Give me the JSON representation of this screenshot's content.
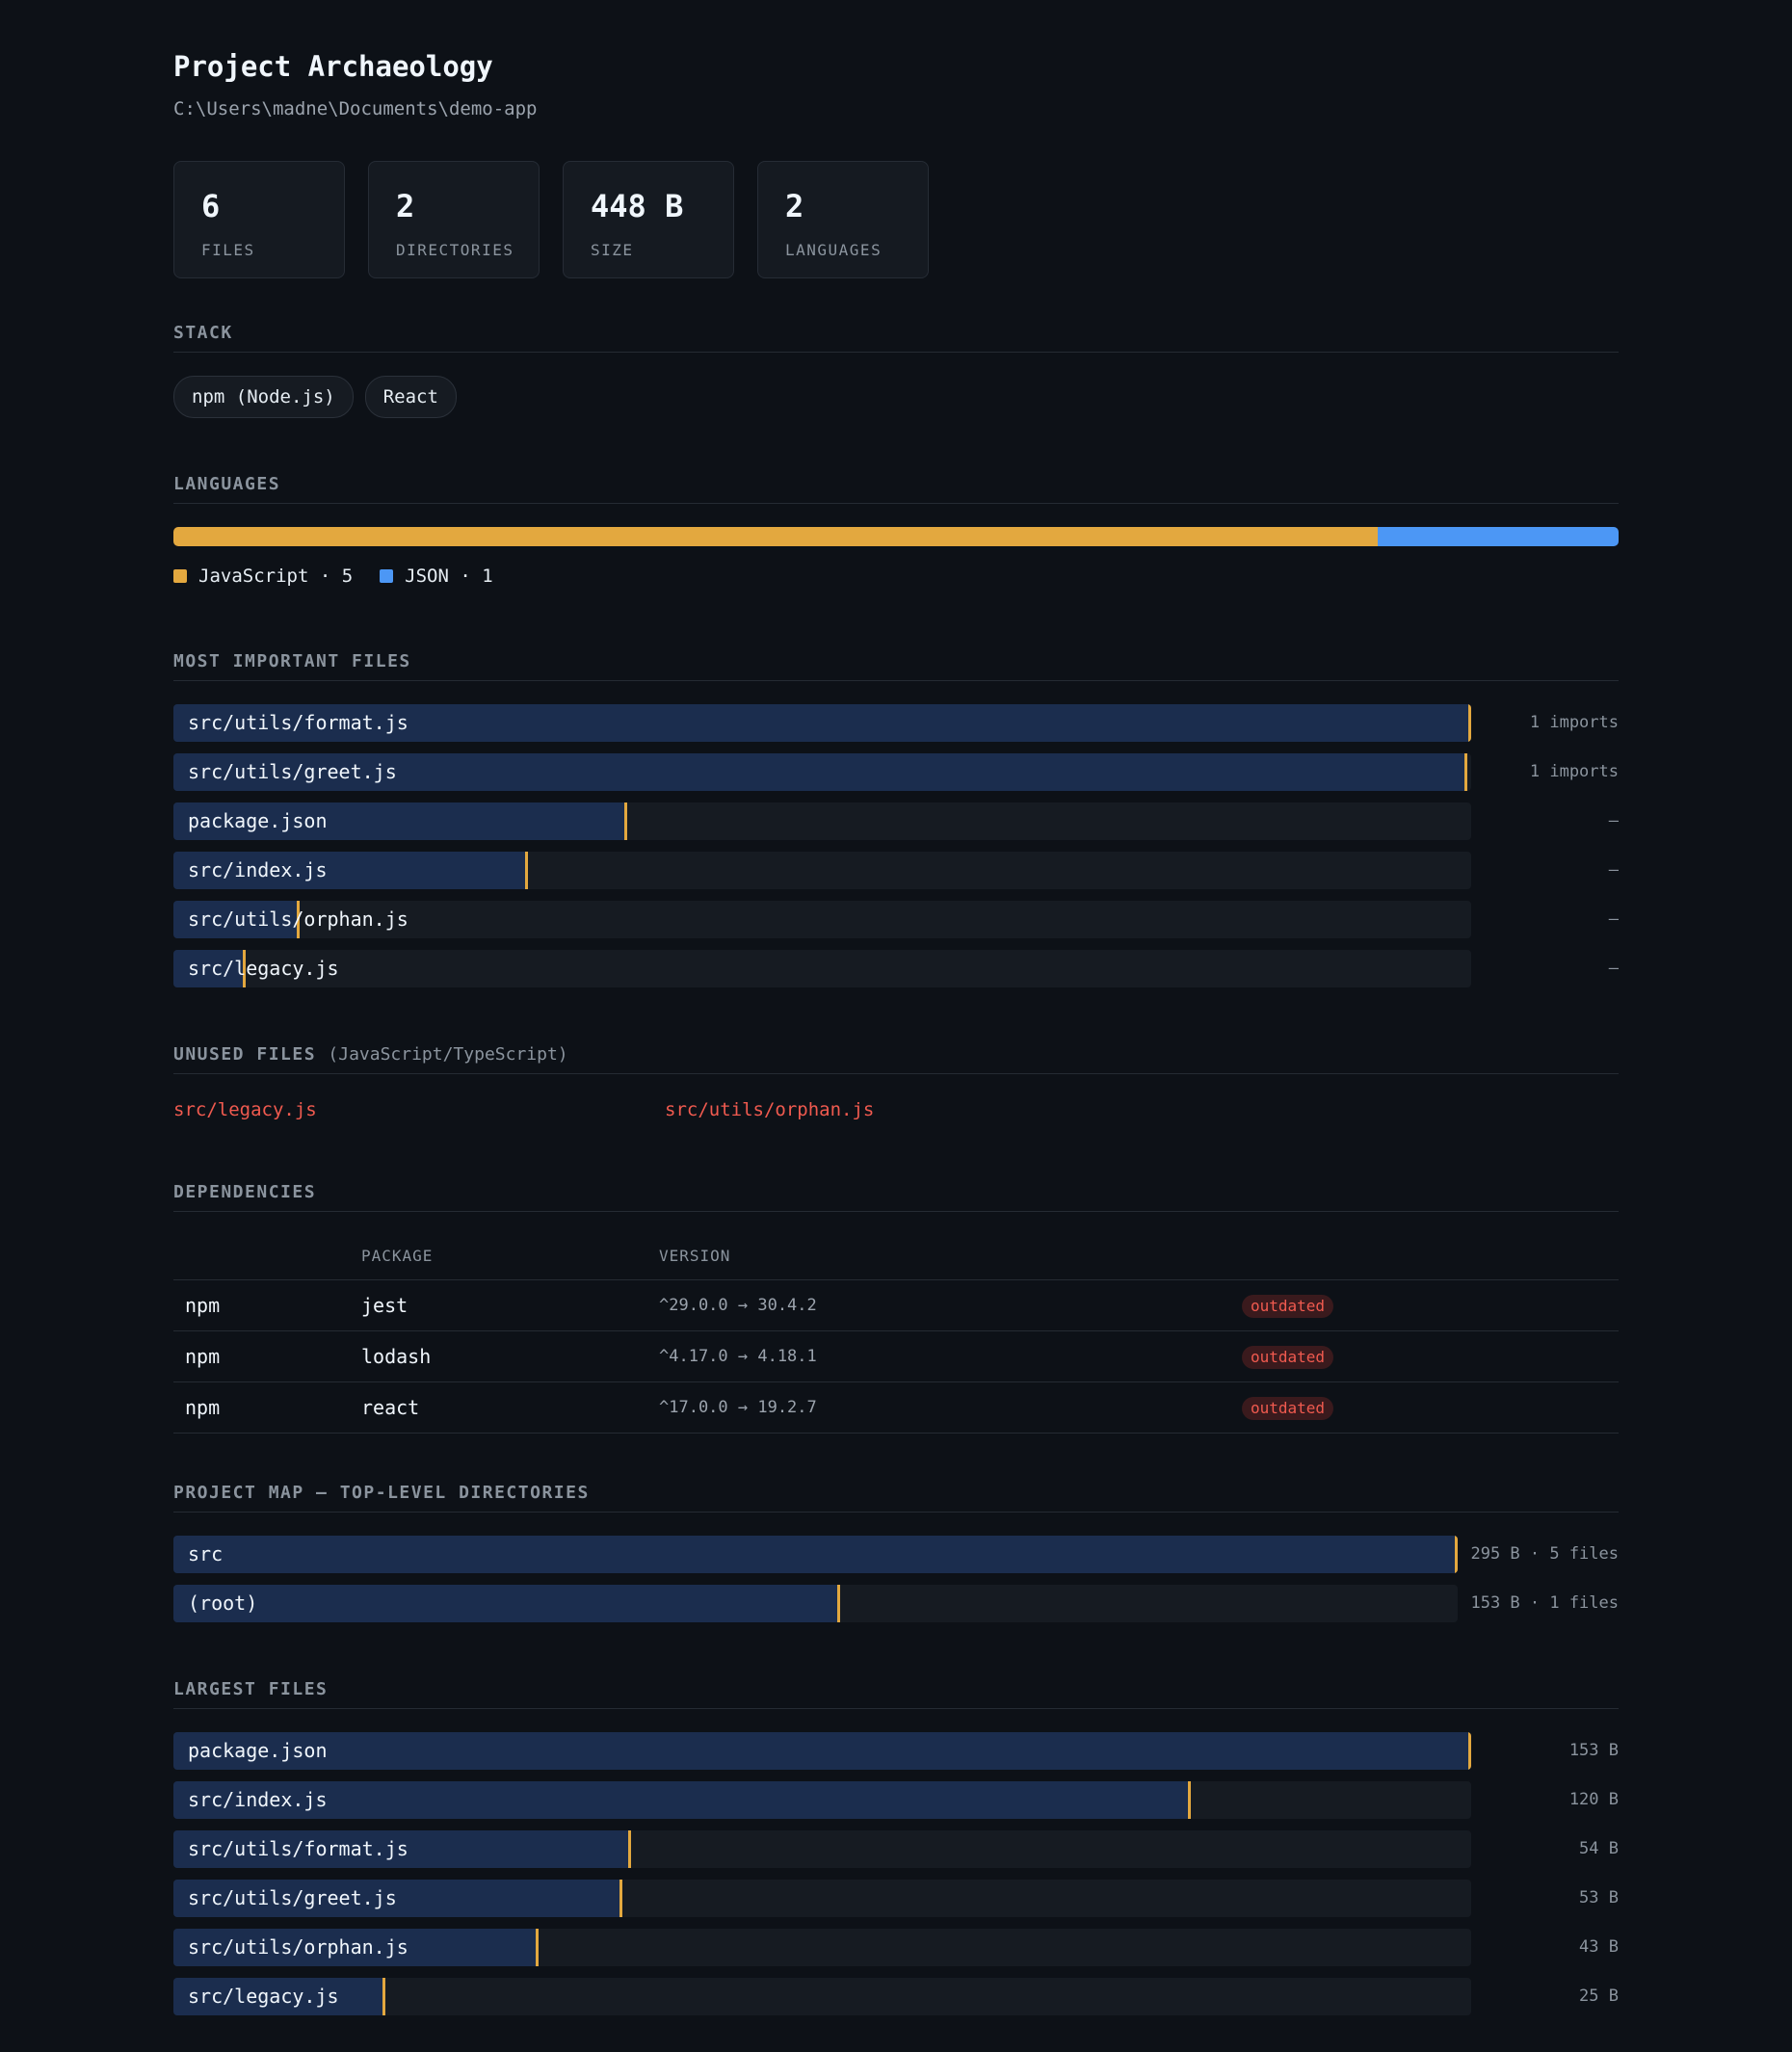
{
  "header": {
    "title": "Project Archaeology",
    "path": "C:\\Users\\madne\\Documents\\demo-app"
  },
  "stats": [
    {
      "value": "6",
      "label": "FILES"
    },
    {
      "value": "2",
      "label": "DIRECTORIES"
    },
    {
      "value": "448 B",
      "label": "SIZE"
    },
    {
      "value": "2",
      "label": "LANGUAGES"
    }
  ],
  "stack": {
    "title": "STACK",
    "items": [
      "npm (Node.js)",
      "React"
    ]
  },
  "languages": {
    "title": "LANGUAGES",
    "items": [
      {
        "name": "JavaScript",
        "count": 5,
        "color": "#e3a83f",
        "legend": "JavaScript · 5"
      },
      {
        "name": "JSON",
        "count": 1,
        "color": "#4c97f5",
        "legend": "JSON · 1"
      }
    ]
  },
  "important_files": {
    "title": "MOST IMPORTANT FILES",
    "rows": [
      {
        "name": "src/utils/format.js",
        "fraction": 1.0,
        "value": "1 imports"
      },
      {
        "name": "src/utils/greet.js",
        "fraction": 0.997,
        "value": "1 imports"
      },
      {
        "name": "package.json",
        "fraction": 0.35,
        "value": "–"
      },
      {
        "name": "src/index.js",
        "fraction": 0.273,
        "value": "–"
      },
      {
        "name": "src/utils/orphan.js",
        "fraction": 0.097,
        "value": "–"
      },
      {
        "name": "src/legacy.js",
        "fraction": 0.056,
        "value": "–"
      }
    ]
  },
  "unused": {
    "title": "UNUSED FILES",
    "subtitle": "(JavaScript/TypeScript)",
    "files": [
      "src/legacy.js",
      "src/utils/orphan.js"
    ]
  },
  "dependencies": {
    "title": "DEPENDENCIES",
    "columns": [
      "",
      "PACKAGE",
      "VERSION",
      ""
    ],
    "rows": [
      {
        "manager": "npm",
        "package": "jest",
        "version": "^29.0.0 → 30.4.2",
        "status": "outdated"
      },
      {
        "manager": "npm",
        "package": "lodash",
        "version": "^4.17.0 → 4.18.1",
        "status": "outdated"
      },
      {
        "manager": "npm",
        "package": "react",
        "version": "^17.0.0 → 19.2.7",
        "status": "outdated"
      }
    ]
  },
  "project_map": {
    "title": "PROJECT MAP — TOP-LEVEL DIRECTORIES",
    "rows": [
      {
        "name": "src",
        "fraction": 1.0,
        "value": "295 B · 5 files"
      },
      {
        "name": "(root)",
        "fraction": 0.519,
        "value": "153 B · 1 files"
      }
    ]
  },
  "largest_files": {
    "title": "LARGEST FILES",
    "rows": [
      {
        "name": "package.json",
        "fraction": 1.0,
        "value": "153 B"
      },
      {
        "name": "src/index.js",
        "fraction": 0.784,
        "value": "120 B"
      },
      {
        "name": "src/utils/format.js",
        "fraction": 0.353,
        "value": "54 B"
      },
      {
        "name": "src/utils/greet.js",
        "fraction": 0.346,
        "value": "53 B"
      },
      {
        "name": "src/utils/orphan.js",
        "fraction": 0.281,
        "value": "43 B"
      },
      {
        "name": "src/legacy.js",
        "fraction": 0.163,
        "value": "25 B"
      }
    ]
  }
}
